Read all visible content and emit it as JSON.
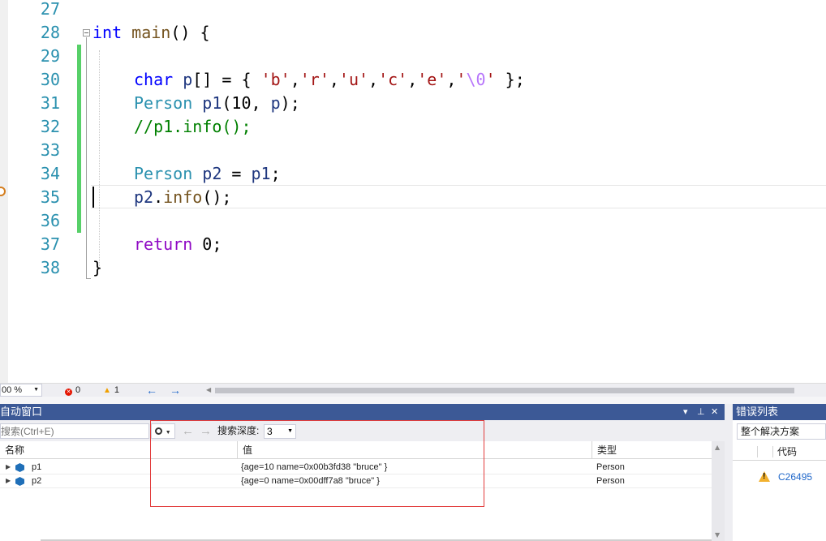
{
  "editor": {
    "lines": [
      {
        "num": "27"
      },
      {
        "num": "28"
      },
      {
        "num": "29"
      },
      {
        "num": "30"
      },
      {
        "num": "31"
      },
      {
        "num": "32"
      },
      {
        "num": "33"
      },
      {
        "num": "34"
      },
      {
        "num": "35"
      },
      {
        "num": "36"
      },
      {
        "num": "37"
      },
      {
        "num": "38"
      }
    ],
    "code": {
      "l28": {
        "kw": "int",
        "fn": "main",
        "rest": "() {"
      },
      "l30": {
        "kw": "char",
        "var": "p",
        "p1": "[] = { ",
        "s1": "'b'",
        "s2": "'r'",
        "s3": "'u'",
        "s4": "'c'",
        "s5": "'e'",
        "s6a": "'",
        "s6b": "\\0",
        "s6c": "'",
        "end": " };",
        "comma": ","
      },
      "l31": {
        "type": "Person",
        "var": "p1",
        "open": "(10, ",
        "arg": "p",
        "close": ");"
      },
      "l32": {
        "comment": "//p1.info();"
      },
      "l34": {
        "type": "Person",
        "var": "p2",
        "eq": " = ",
        "src": "p1",
        "semi": ";"
      },
      "l35": {
        "var": "p2",
        "dot": ".",
        "fn": "info",
        "rest": "();"
      },
      "l37": {
        "kw": "return",
        "rest": " 0;"
      },
      "l38": {
        "rest": "}"
      }
    }
  },
  "status_strip": {
    "zoom": "00 %",
    "errors": "0",
    "warnings": "1",
    "back": "←",
    "forward": "→"
  },
  "autos": {
    "title": "自动窗口",
    "search_placeholder": "搜索(Ctrl+E)",
    "depth_label": "搜索深度:",
    "depth_value": "3",
    "columns": {
      "name": "名称",
      "value": "值",
      "type": "类型"
    },
    "rows": [
      {
        "name": "p1",
        "value": "{age=10 name=0x00b3fd38 \"bruce\" }",
        "type": "Person"
      },
      {
        "name": "p2",
        "value": "{age=0 name=0x00dff7a8 \"bruce\" }",
        "type": "Person"
      }
    ]
  },
  "error_list": {
    "title": "错误列表",
    "scope": "整个解决方案",
    "code_header": "代码",
    "items": [
      {
        "code": "C26495"
      }
    ]
  },
  "colors": {
    "keyword": "#0000ff",
    "control_keyword": "#8f08c4",
    "type": "#2b91af",
    "string": "#a31515",
    "comment": "#008000",
    "panel_title": "#3c5996",
    "highlight_box": "#e23c3c"
  }
}
